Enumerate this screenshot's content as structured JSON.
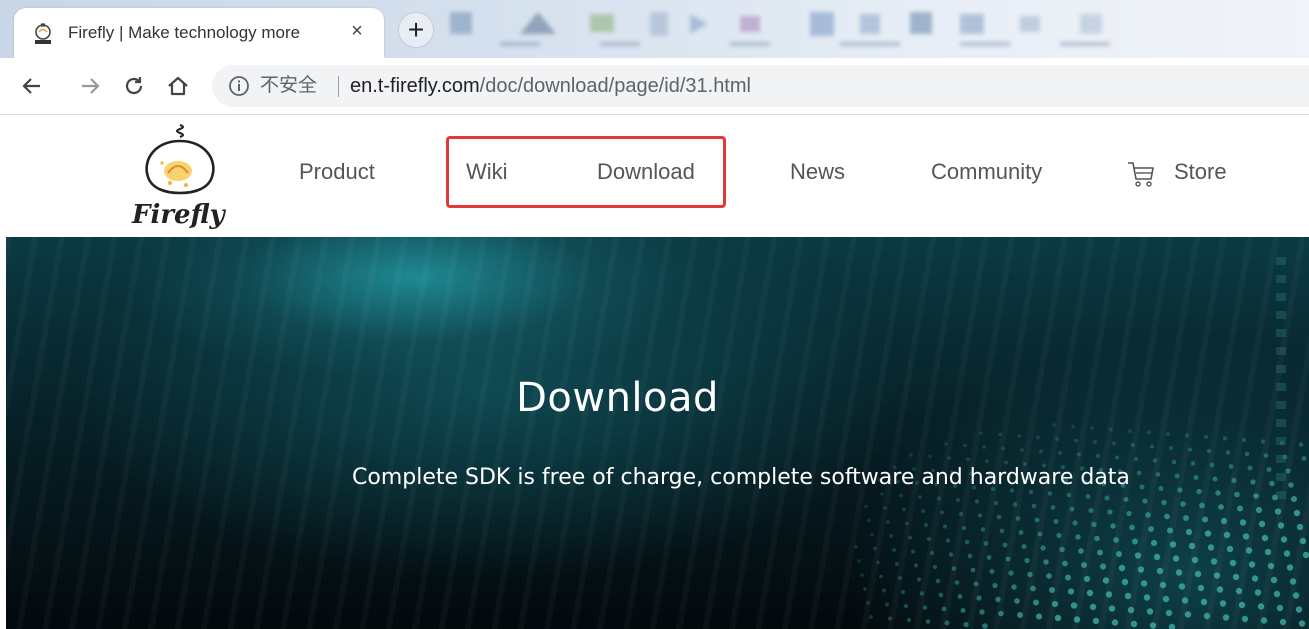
{
  "browser": {
    "tab": {
      "title": "Firefly | Make technology more",
      "favicon": "firefly-logo-icon",
      "close_glyph": "×"
    },
    "new_tab_glyph": "+",
    "toolbar": {
      "back_icon": "arrow-left-icon",
      "forward_icon": "arrow-right-icon",
      "reload_icon": "reload-icon",
      "home_icon": "home-icon"
    },
    "omnibox": {
      "security_label": "不安全",
      "url_host": "en.t-firefly.com",
      "url_path": "/doc/download/page/id/31.html"
    }
  },
  "site": {
    "logo_text": "Firefly",
    "nav": {
      "items": [
        {
          "label": "Product"
        },
        {
          "label": "Wiki"
        },
        {
          "label": "Download"
        },
        {
          "label": "News"
        },
        {
          "label": "Community"
        },
        {
          "label": "Store"
        }
      ],
      "store_icon": "cart-icon",
      "highlight_color": "#e03a3a"
    },
    "hero": {
      "title": "Download",
      "subtitle": "Complete SDK is free of charge, complete software and hardware data"
    }
  }
}
